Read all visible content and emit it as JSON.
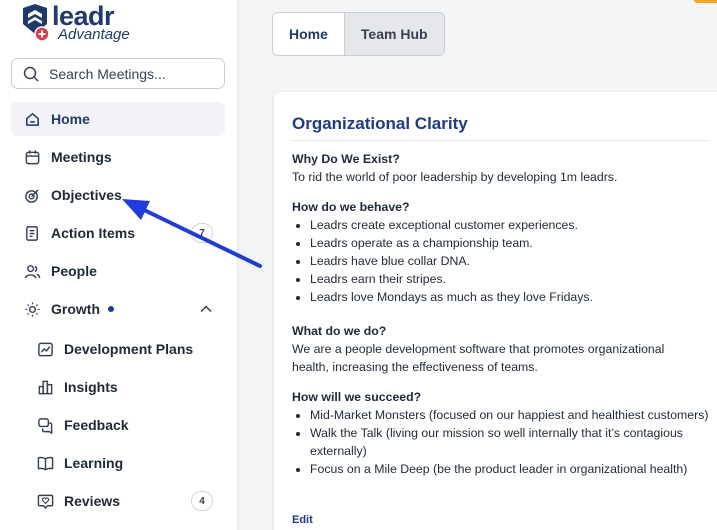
{
  "brand": {
    "name": "leadr",
    "tagline": "Advantage",
    "color": "#1f3a6e"
  },
  "search": {
    "placeholder": "Search Meetings..."
  },
  "nav": {
    "home": "Home",
    "meetings": "Meetings",
    "objectives": "Objectives",
    "action_items": "Action Items",
    "action_items_count": "7",
    "people": "People",
    "growth": "Growth",
    "development_plans": "Development Plans",
    "insights": "Insights",
    "feedback": "Feedback",
    "learning": "Learning",
    "reviews": "Reviews",
    "reviews_count": "4"
  },
  "tabs": {
    "home": "Home",
    "team_hub": "Team Hub"
  },
  "card": {
    "title": "Organizational Clarity",
    "q1": {
      "heading": "Why Do We Exist?",
      "text": "To rid the world of poor leadership by developing 1m leadrs."
    },
    "q2": {
      "heading": "How do we behave?",
      "items": [
        "Leadrs create exceptional customer experiences.",
        "Leadrs operate as a championship team.",
        "Leadrs have blue collar DNA.",
        "Leadrs earn their stripes.",
        "Leadrs love Mondays as much as they love Fridays."
      ]
    },
    "q3": {
      "heading": "What do we do?",
      "text": "We are a people development software that promotes organizational health, increasing the effectiveness of teams."
    },
    "q4": {
      "heading": "How will we succeed?",
      "items": [
        "Mid-Market Monsters (focused on our happiest and healthiest customers)",
        "Walk the Talk (living our mission so well internally that it’s contagious externally)",
        "Focus on a Mile Deep (be the product leader in organizational health)"
      ]
    },
    "edit": "Edit"
  },
  "colors": {
    "annotation_arrow": "#1f3ae0",
    "accent": "#f5a623",
    "active_bg": "#f1f3f6"
  }
}
